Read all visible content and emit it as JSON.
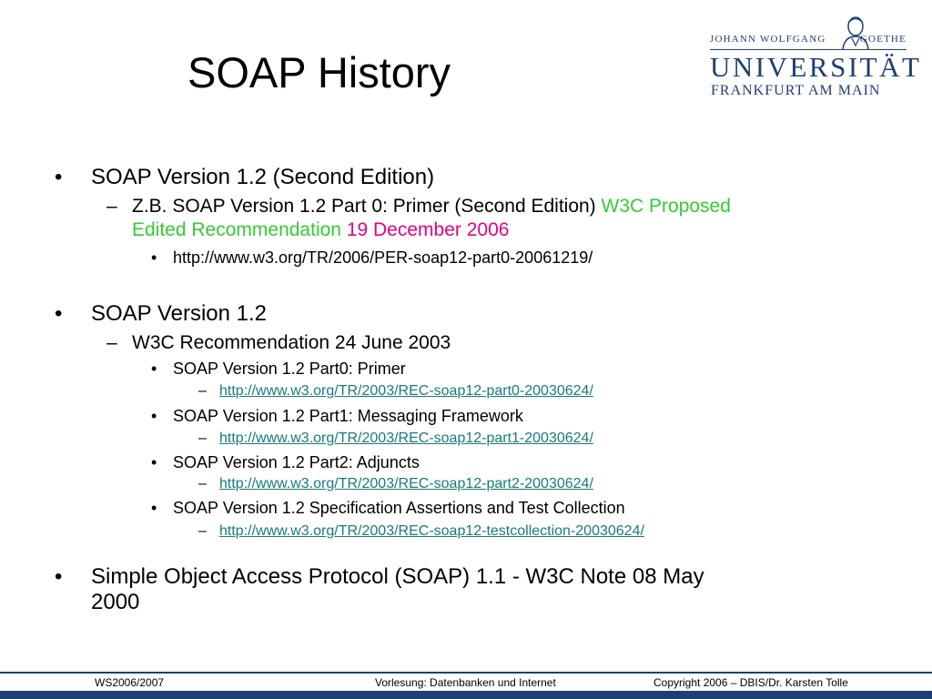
{
  "slide": {
    "title": "SOAP History"
  },
  "logo": {
    "top_left": "JOHANN WOLFGANG",
    "top_right": "GOETHE",
    "university": "UNIVERSITÄT",
    "city": "FRANKFURT AM MAIN"
  },
  "content": {
    "b1": {
      "text": "SOAP Version 1.2 (Second Edition)",
      "sub_prefix": "Z.B. SOAP Version 1.2 Part 0: Primer (Second Edition)",
      "sub_green_1": "W3C Proposed",
      "sub_green_2": "Edited Recommendation",
      "sub_date": "19 December 2006",
      "url": "http://www.w3.org/TR/2006/PER-soap12-part0-20061219/"
    },
    "b2": {
      "text": "SOAP Version 1.2",
      "sub": "W3C Recommendation 24 June 2003",
      "items": [
        {
          "label": "SOAP Version 1.2 Part0: Primer",
          "url": "http://www.w3.org/TR/2003/REC-soap12-part0-20030624/"
        },
        {
          "label": "SOAP Version 1.2 Part1: Messaging Framework",
          "url": "http://www.w3.org/TR/2003/REC-soap12-part1-20030624/"
        },
        {
          "label": "SOAP Version 1.2 Part2: Adjuncts",
          "url": "http://www.w3.org/TR/2003/REC-soap12-part2-20030624/"
        },
        {
          "label": "SOAP Version 1.2 Specification Assertions and Test Collection",
          "url": "http://www.w3.org/TR/2003/REC-soap12-testcollection-20030624/"
        }
      ]
    },
    "b3": {
      "line1": "Simple Object Access Protocol (SOAP) 1.1 - W3C Note 08 May",
      "line2": "2000"
    }
  },
  "footer": {
    "semester": "WS2006/2007",
    "course": "Vorlesung: Datenbanken und Internet",
    "copyright": "Copyright 2006 – DBIS/Dr. Karsten Tolle"
  },
  "glyphs": {
    "bullet": "•",
    "dash": "–"
  },
  "colors": {
    "brand_blue": "#1f3f73",
    "green": "#33cc33",
    "magenta": "#e6007e",
    "link": "#1a7a7a"
  }
}
